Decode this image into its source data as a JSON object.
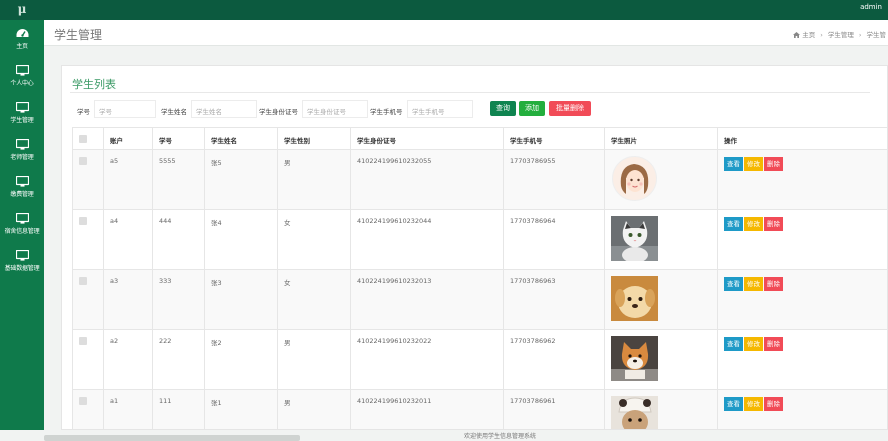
{
  "topbar": {
    "logo": "μ",
    "user": "admin"
  },
  "sidebar": {
    "items": [
      {
        "label": "主页",
        "icon": "dashboard-icon"
      },
      {
        "label": "个人中心",
        "icon": "monitor-icon"
      },
      {
        "label": "学生管理",
        "icon": "monitor-icon"
      },
      {
        "label": "老师管理",
        "icon": "monitor-icon"
      },
      {
        "label": "缴费管理",
        "icon": "monitor-icon"
      },
      {
        "label": "宿舍信息管理",
        "icon": "monitor-icon"
      },
      {
        "label": "基础数据管理",
        "icon": "monitor-icon"
      }
    ]
  },
  "header": {
    "title": "学生管理",
    "breadcrumb": [
      "主页",
      "学生管理",
      "学生管"
    ]
  },
  "panel": {
    "title": "学生列表"
  },
  "search": {
    "fields": [
      {
        "label": "学号",
        "placeholder": "学号"
      },
      {
        "label": "学生姓名",
        "placeholder": "学生姓名"
      },
      {
        "label": "学生身份证号",
        "placeholder": "学生身份证号"
      },
      {
        "label": "学生手机号",
        "placeholder": "学生手机号"
      }
    ],
    "btn_search": "查询",
    "btn_add": "添加",
    "btn_batch_delete": "批量删除"
  },
  "table": {
    "headers": [
      "账户",
      "学号",
      "学生姓名",
      "学生性别",
      "学生身份证号",
      "学生手机号",
      "学生照片",
      "操作"
    ],
    "actions": {
      "view": "查看",
      "edit": "修改",
      "delete": "删除"
    },
    "rows": [
      {
        "account": "a5",
        "id": "5555",
        "name": "张5",
        "gender": "男",
        "idcard": "410224199610232055",
        "phone": "17703786955",
        "photo": "girl-avatar"
      },
      {
        "account": "a4",
        "id": "444",
        "name": "张4",
        "gender": "女",
        "idcard": "410224199610232044",
        "phone": "17703786964",
        "photo": "cat"
      },
      {
        "account": "a3",
        "id": "333",
        "name": "张3",
        "gender": "女",
        "idcard": "410224199610232013",
        "phone": "17703786963",
        "photo": "puppy"
      },
      {
        "account": "a2",
        "id": "222",
        "name": "张2",
        "gender": "男",
        "idcard": "410224199610232022",
        "phone": "17703786962",
        "photo": "shiba-dog"
      },
      {
        "account": "a1",
        "id": "111",
        "name": "张1",
        "gender": "男",
        "idcard": "410224199610232011",
        "phone": "17703786961",
        "photo": "dog-in-hat"
      }
    ]
  },
  "footer": {
    "text": "欢迎使用学生信息管理系统"
  },
  "colors": {
    "topbar": "#0c5a3f",
    "sidebar": "#0f7a4b",
    "accent": "#3a9a65",
    "view": "#1e9ac7",
    "edit": "#f5b800",
    "delete": "#f14b57"
  }
}
